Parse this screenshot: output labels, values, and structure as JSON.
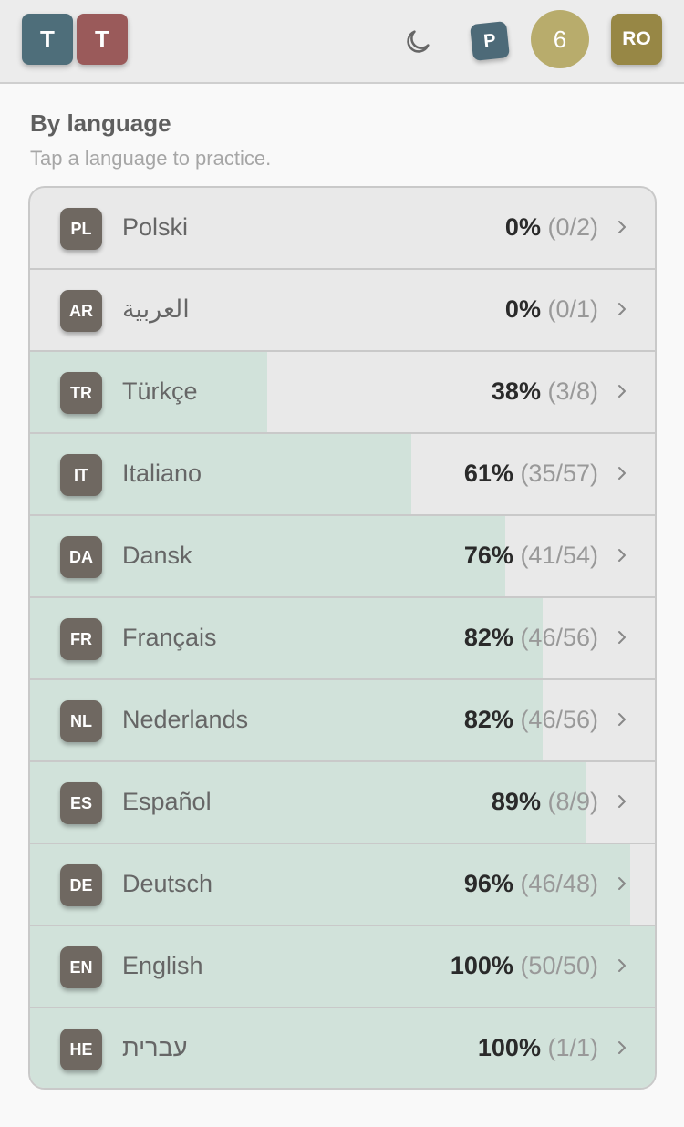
{
  "header": {
    "logo_letters": [
      "T",
      "T"
    ],
    "icons": {
      "theme_toggle": "moon-icon"
    },
    "p_badge": "P",
    "count": "6",
    "user_initials": "RO"
  },
  "section": {
    "title": "By language",
    "subtitle": "Tap a language to practice."
  },
  "colors": {
    "progress_fill": "#d1e2da",
    "code_badge": "#6f6861",
    "count_badge": "#b8ac6c",
    "user_badge": "#978745"
  },
  "languages": [
    {
      "code": "PL",
      "name": "Polski",
      "percent": "0%",
      "fraction": "(0/2)",
      "progress": 0.0
    },
    {
      "code": "AR",
      "name": "العربية",
      "percent": "0%",
      "fraction": "(0/1)",
      "progress": 0.0
    },
    {
      "code": "TR",
      "name": "Türkçe",
      "percent": "38%",
      "fraction": "(3/8)",
      "progress": 0.38
    },
    {
      "code": "IT",
      "name": "Italiano",
      "percent": "61%",
      "fraction": "(35/57)",
      "progress": 0.61
    },
    {
      "code": "DA",
      "name": "Dansk",
      "percent": "76%",
      "fraction": "(41/54)",
      "progress": 0.76
    },
    {
      "code": "FR",
      "name": "Français",
      "percent": "82%",
      "fraction": "(46/56)",
      "progress": 0.82
    },
    {
      "code": "NL",
      "name": "Nederlands",
      "percent": "82%",
      "fraction": "(46/56)",
      "progress": 0.82
    },
    {
      "code": "ES",
      "name": "Español",
      "percent": "89%",
      "fraction": "(8/9)",
      "progress": 0.89
    },
    {
      "code": "DE",
      "name": "Deutsch",
      "percent": "96%",
      "fraction": "(46/48)",
      "progress": 0.96
    },
    {
      "code": "EN",
      "name": "English",
      "percent": "100%",
      "fraction": "(50/50)",
      "progress": 1.0
    },
    {
      "code": "HE",
      "name": "עברית",
      "percent": "100%",
      "fraction": "(1/1)",
      "progress": 1.0
    }
  ]
}
